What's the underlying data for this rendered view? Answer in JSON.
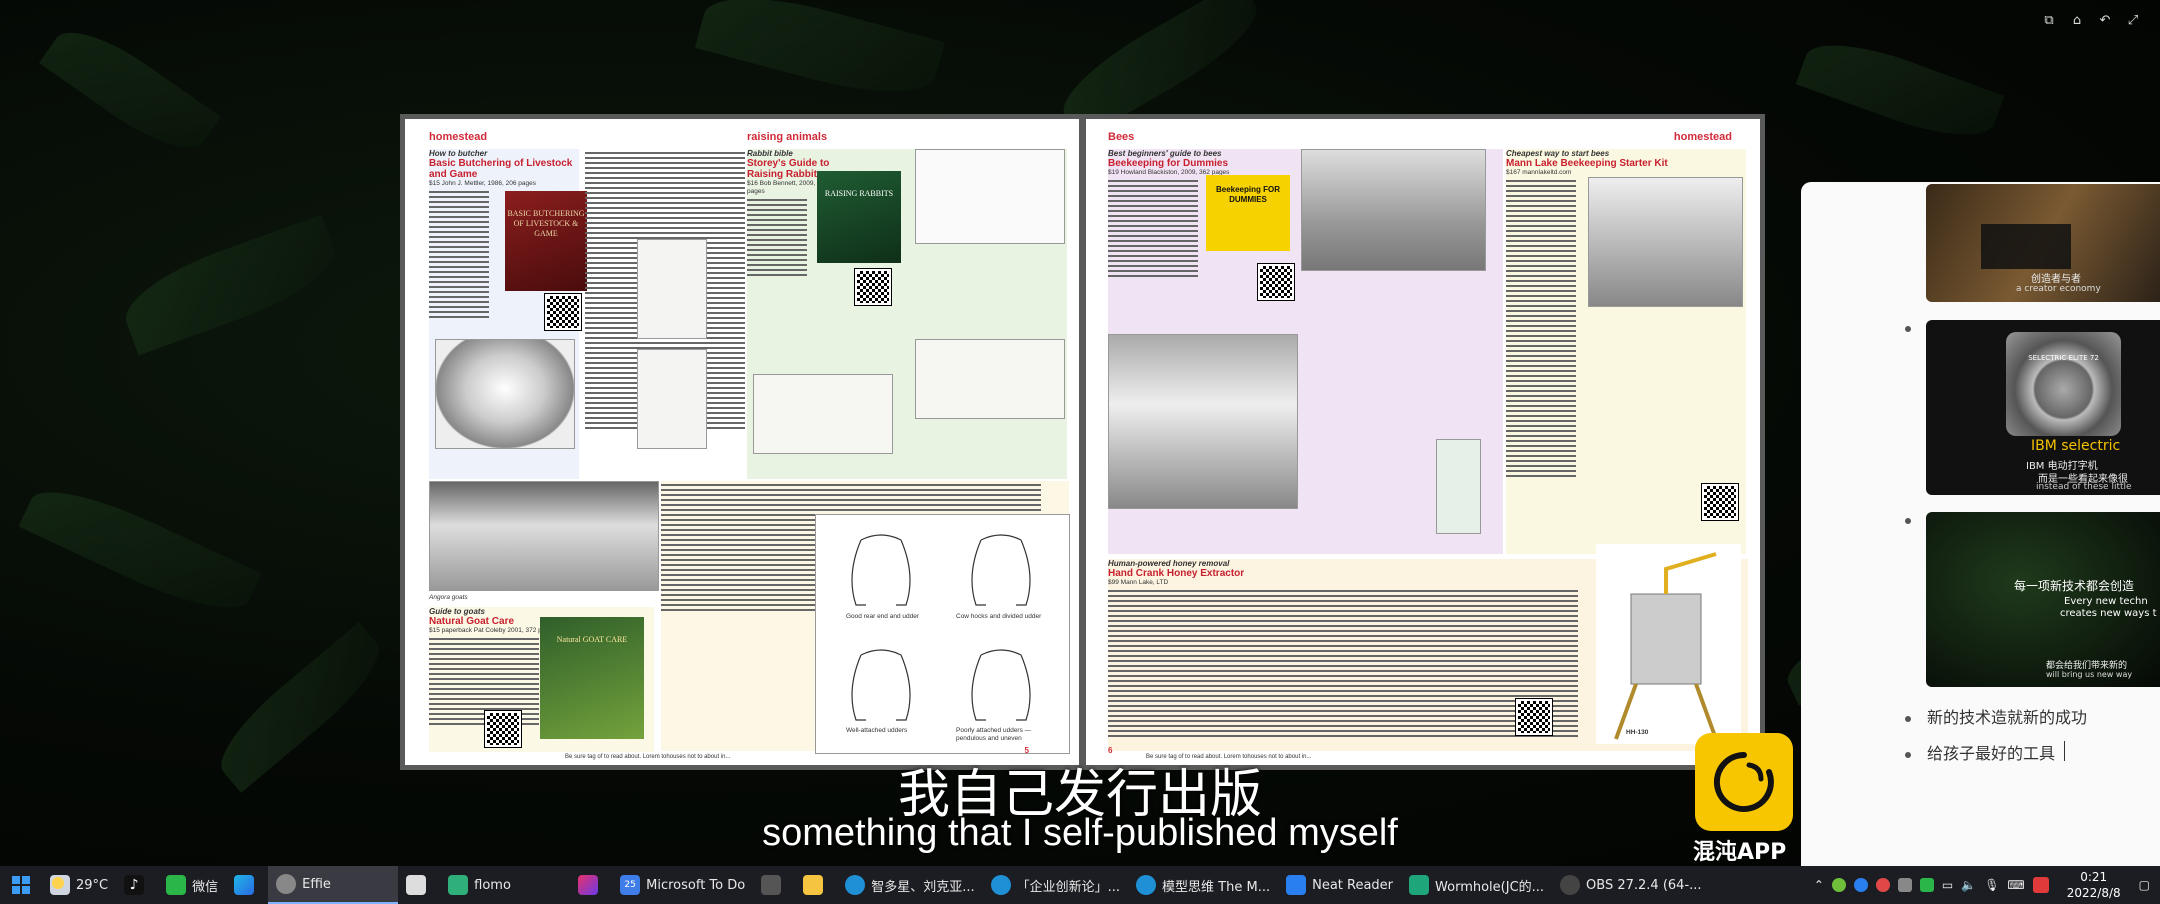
{
  "window_controls": [
    "pip-icon",
    "home-icon",
    "back-icon",
    "fullscreen-icon"
  ],
  "magazine": {
    "left_page": {
      "header_left": "homestead",
      "header_right": "raising animals",
      "page_number": "5",
      "articles": [
        {
          "kicker": "How to butcher",
          "title": "Basic Butchering of Livestock and Game",
          "byline": "$15 John J. Mettler, 1986, 206 pages"
        },
        {
          "kicker": "Rabbit bible",
          "title": "Storey's Guide to Raising Rabbits",
          "byline": "$16 Bob Bennett, 2009, 352 pages"
        },
        {
          "kicker": "Guide to goats",
          "title": "Natural Goat Care",
          "byline": "$15 paperback Pat Coleby 2001, 372 pages"
        }
      ],
      "book_covers": [
        "BASIC BUTCHERING OF LIVESTOCK & GAME",
        "RAISING RABBITS",
        "Natural GOAT CARE"
      ],
      "captions": [
        "Angora goats",
        "Good rear end and udder",
        "Cow hocks and divided udder",
        "Well-attached udders",
        "Poorly attached udders — pendulous and uneven"
      ],
      "footer": "Be sure tag of to read about. Lorem tohouses not to about in..."
    },
    "right_page": {
      "header_left": "Bees",
      "header_right": "homestead",
      "page_number": "6",
      "articles": [
        {
          "kicker": "Best beginners' guide to bees",
          "title": "Beekeeping for Dummies",
          "byline": "$19 Howland Blackiston, 2009, 362 pages"
        },
        {
          "kicker": "Cheapest way to start bees",
          "title": "Mann Lake Beekeeping Starter Kit",
          "byline": "$167 mannlakeltd.com"
        },
        {
          "kicker": "Human-powered honey removal",
          "title": "Hand Crank Honey Extractor",
          "byline": "$99 Mann Lake, LTD"
        }
      ],
      "book_covers": [
        "Beekeeping FOR DUMMIES"
      ],
      "product_label": "HH-130",
      "footer": "Be sure tag of to read about. Lorem tohouses not to about in..."
    }
  },
  "subtitles": {
    "chinese": "我自己发行出版",
    "english": "something that I self-published myself"
  },
  "logo": {
    "text": "混沌APP"
  },
  "side_panel": {
    "thumb1_caption": "创造者与者",
    "thumb1_sub": "a creator economy",
    "thumb2_caption": "IBM selectric",
    "thumb2_sub1": "IBM 电动打字机",
    "thumb2_sub2": "而是一些看起来像很",
    "thumb2_sub3": "instead of these little",
    "thumb2_device": "SELECTRIC ELITE 72",
    "thumb3_caption": "每一项新技术都会创造",
    "thumb3_sub1": "Every new techn",
    "thumb3_sub2": "creates new ways t",
    "thumb3_sub3": "都会给我们带来新的",
    "thumb3_sub4": "will bring us new way",
    "list_items": [
      "新的技术造就新的成功",
      "给孩子最好的工具"
    ]
  },
  "taskbar": {
    "weather": "29°C",
    "items": [
      {
        "label": "微信",
        "color": "#2bb64a"
      },
      {
        "label": "Effie",
        "color": "#888",
        "active": true
      },
      {
        "label": "flomo",
        "color": "#2fb07a"
      },
      {
        "label": "Microsoft To Do",
        "color": "#3f7ee8",
        "badge": "25"
      },
      {
        "label": "智多星、刘克亚...",
        "color": "#1f8fd6"
      },
      {
        "label": "「企业创新论」...",
        "color": "#1f8fd6"
      },
      {
        "label": "模型思维 The M...",
        "color": "#1f8fd6"
      },
      {
        "label": "Neat Reader",
        "color": "#2a7ff0"
      },
      {
        "label": "Wormhole(JC的...",
        "color": "#1ea67a"
      },
      {
        "label": "OBS 27.2.4 (64-...",
        "color": "#444"
      }
    ],
    "time": "0:21",
    "date": "2022/8/8"
  }
}
